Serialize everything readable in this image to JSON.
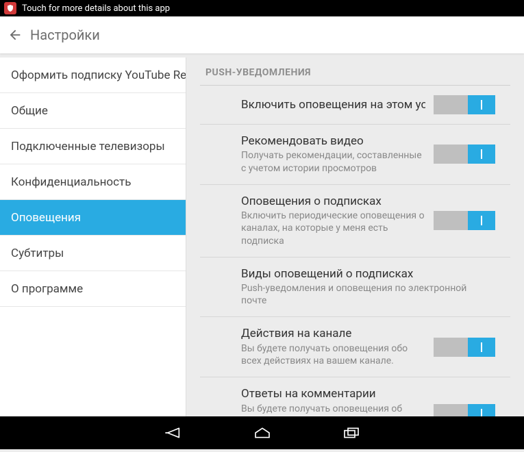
{
  "status": {
    "text": "Touch for more details about this app"
  },
  "header": {
    "title": "Настройки"
  },
  "sidebar": {
    "items": [
      {
        "label": "Оформить подписку YouTube Red"
      },
      {
        "label": "Общие"
      },
      {
        "label": "Подключенные телевизоры"
      },
      {
        "label": "Конфиденциальность"
      },
      {
        "label": "Оповещения"
      },
      {
        "label": "Субтитры"
      },
      {
        "label": "О программе"
      }
    ]
  },
  "main": {
    "section_header": "PUSH-УВЕДОМЛЕНИЯ",
    "settings": [
      {
        "title": "Включить оповещения на этом устройстве",
        "desc": "",
        "toggle": true
      },
      {
        "title": "Рекомендовать видео",
        "desc": "Получать рекомендации, составленные с учетом истории просмотров",
        "toggle": true
      },
      {
        "title": "Оповещения о подписках",
        "desc": "Включить периодические оповещения о каналах, на которые у меня есть подписка",
        "toggle": true
      },
      {
        "title": "Виды оповещений о подписках",
        "desc": "Push-уведомления и оповещения по электронной почте",
        "toggle": false
      },
      {
        "title": "Действия на канале",
        "desc": "Вы будете получать оповещения обо всех действиях на вашем канале.",
        "toggle": true
      },
      {
        "title": "Ответы на комментарии",
        "desc": "Вы будете получать оповещения об ответах на ваши комментарии к роликам других авторов.",
        "toggle": true
      }
    ]
  }
}
